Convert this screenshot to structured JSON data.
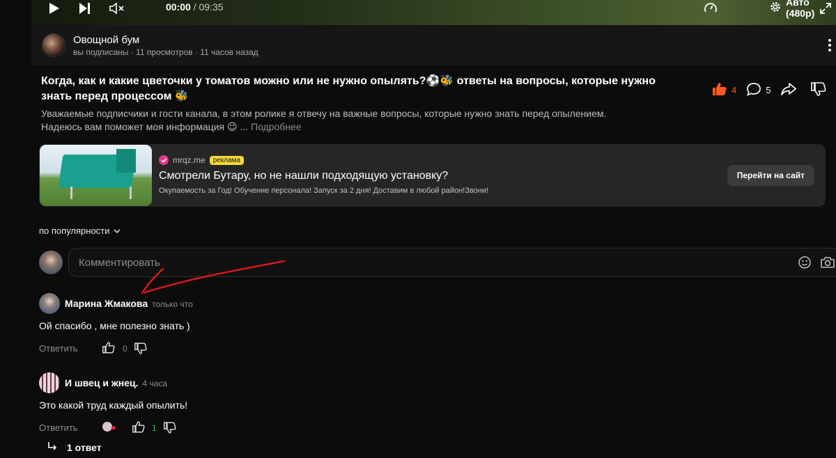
{
  "player": {
    "current_time": "00:00",
    "duration": "/ 09:35",
    "quality": "Авто (480p)"
  },
  "channel": {
    "name": "Овощной бум",
    "meta": "вы подписаны · 11 просмотров · 11 часов назад"
  },
  "video": {
    "title": "Когда, как и какие цветочки у томатов можно или не нужно опылять?⚽🐝 ответы на вопросы, которые нужно знать перед процессом 🐝",
    "likes": "4",
    "comments": "5",
    "description_line1": "Уважаемые подписчики и гости канала, в этом ролике я отвечу на важные вопросы, которые нужно знать перед опылением.",
    "description_line2": "Надеюсь вам поможет моя информация 😉 ...",
    "more": "Подробнее"
  },
  "ad": {
    "domain": "mrqz.me",
    "badge": "реклама",
    "headline": "Смотрели Бутару, но не нашли подходящую установку?",
    "subtext": "Окупаемость за Год! Обучение персонала! Запуск за 2 дня! Доставим в любой район!Звони!",
    "button": "Перейти на сайт"
  },
  "sort": {
    "label": "по популярности"
  },
  "comment_input": {
    "placeholder": "Комментировать"
  },
  "comments": [
    {
      "author": "Марина Жмакова",
      "time": "только что",
      "text": "Ой спасибо , мне полезно знать )",
      "reply": "Ответить",
      "likes": "0"
    },
    {
      "author": "И швец и жнец.",
      "time": "4 часа",
      "text": "Это какой труд каждый опылить!",
      "reply": "Ответить",
      "likes": "1",
      "replies": "1 ответ"
    }
  ],
  "colors": {
    "accent_like": "#ff5a1f",
    "ad_badge": "#f4d93b",
    "ad_check": "#e3358a",
    "annotation_arrow": "#d61a1a",
    "positive_count": "#3db34a"
  }
}
